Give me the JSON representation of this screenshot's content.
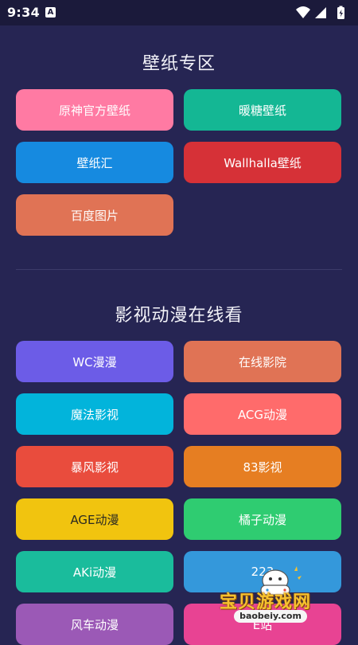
{
  "status_bar": {
    "time": "9:34",
    "notification_badge": "A"
  },
  "sections": [
    {
      "title": "壁纸专区",
      "buttons": [
        {
          "label": "原神官方壁纸",
          "color": "#ff7aa3"
        },
        {
          "label": "暖糖壁纸",
          "color": "#14b794"
        },
        {
          "label": "壁纸汇",
          "color": "#168ae0"
        },
        {
          "label": "Wallhalla壁纸",
          "color": "#d63137"
        },
        {
          "label": "百度图片",
          "color": "#e07355"
        }
      ]
    },
    {
      "title": "影视动漫在线看",
      "buttons": [
        {
          "label": "WC漫漫",
          "color": "#6c5ce7"
        },
        {
          "label": "在线影院",
          "color": "#e07355"
        },
        {
          "label": "魔法影视",
          "color": "#02b4db"
        },
        {
          "label": "ACG动漫",
          "color": "#ff6b6b"
        },
        {
          "label": "暴风影视",
          "color": "#e94c3d"
        },
        {
          "label": "83影视",
          "color": "#e67e22"
        },
        {
          "label": "AGE动漫",
          "color": "#f1c40f"
        },
        {
          "label": "橘子动漫",
          "color": "#2fcc71"
        },
        {
          "label": "AKi动漫",
          "color": "#1abc9c"
        },
        {
          "label": "223",
          "color": "#3498db"
        },
        {
          "label": "风车动漫",
          "color": "#9b59b6"
        },
        {
          "label": "E站",
          "color": "#e84393"
        }
      ]
    }
  ],
  "watermark": {
    "title": "宝贝游戏网",
    "url": "baobeiy.com"
  }
}
